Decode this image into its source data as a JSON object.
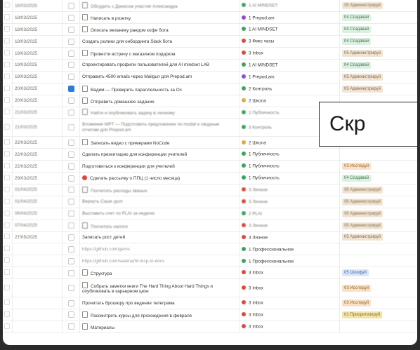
{
  "table": {
    "rows": [
      {
        "date": "16/03/2025",
        "checked": false,
        "icon": "page-icon",
        "task": "Обсудить с Данисом участие Александра",
        "cat": "1 AI MINDSET",
        "cat_color": "#3aa55e",
        "status": "05 Администрируй",
        "status_bg": "#efe5d6",
        "status_fg": "#8a6a3a",
        "blur": true
      },
      {
        "date": "18/03/2025",
        "checked": false,
        "icon": "page-icon",
        "task": "Написать в розетку",
        "cat": "1 Prepod.am",
        "cat_color": "#8a4fd6",
        "status": "04 Создавай",
        "status_bg": "#dcefe0",
        "status_fg": "#3f7a4f",
        "blur": false
      },
      {
        "date": "18/03/2025",
        "checked": false,
        "icon": "page-icon",
        "task": "Описать механику рандом кофе бота",
        "cat": "1 AI MINDSET",
        "cat_color": "#3aa55e",
        "status": "04 Создавай",
        "status_bg": "#dcefe0",
        "status_fg": "#3f7a4f",
        "blur": false
      },
      {
        "date": "18/03/2025",
        "checked": false,
        "icon": "",
        "task": "Создать ролики для онбординга Slack бота",
        "cat": "3 Фикс часы",
        "cat_color": "#e0483c",
        "status": "04 Создавай",
        "status_bg": "#dcefe0",
        "status_fg": "#3f7a4f",
        "blur": false
      },
      {
        "date": "19/03/2025",
        "checked": false,
        "icon": "page-icon",
        "task": "Провести встречу с магазином подарков",
        "cat": "3 Inbox",
        "cat_color": "#e0483c",
        "status": "05 Администрируй",
        "status_bg": "#efe5d6",
        "status_fg": "#8a6a3a",
        "blur": false
      },
      {
        "date": "19/03/2025",
        "checked": false,
        "icon": "",
        "task": "Спроектировать профили пользователей для AI mindset LAB",
        "cat": "1 AI MINDSET",
        "cat_color": "#3aa55e",
        "status": "04 Создавай",
        "status_bg": "#dcefe0",
        "status_fg": "#3f7a4f",
        "blur": false
      },
      {
        "date": "19/03/2025",
        "checked": false,
        "icon": "",
        "task": "Отправить 4500 emails через Mailgun для Prepod.am",
        "cat": "1 Prepod.am",
        "cat_color": "#8a4fd6",
        "status": "05 Администрируй",
        "status_bg": "#efe5d6",
        "status_fg": "#8a6a3a",
        "blur": false
      },
      {
        "date": "20/03/2025",
        "checked": true,
        "icon": "page-icon",
        "task": "Вадим — Проверить параллельность за Ос",
        "cat": "2 Контроль",
        "cat_color": "#3aa55e",
        "status": "05 Администрируй",
        "status_bg": "#efe5d6",
        "status_fg": "#8a6a3a",
        "blur": false
      },
      {
        "date": "20/03/2025",
        "checked": false,
        "icon": "page-icon",
        "task": "Отправить домашнее задание",
        "cat": "2 Школа",
        "cat_color": "#e5a93a",
        "status": "",
        "status_bg": "",
        "status_fg": "",
        "blur": false
      },
      {
        "date": "21/03/2025",
        "checked": false,
        "icon": "page-icon",
        "task": "Найти и опубликовать задачу в личному",
        "cat": "1 Публичность",
        "cat_color": "#3aa55e",
        "status": "",
        "status_bg": "",
        "status_fg": "",
        "blur": true
      },
      {
        "date": "21/03/2025",
        "checked": false,
        "icon": "",
        "task": "Вложение MPT — Подготовить предложение по modal и сводным отчетам для Prepod.am",
        "cat": "3 Контроль",
        "cat_color": "#3aa55e",
        "status": "",
        "status_bg": "",
        "status_fg": "",
        "blur": true,
        "tall": true
      },
      {
        "date": "22/03/2025",
        "checked": false,
        "icon": "page-icon",
        "task": "Записать видео с примерами NoCode",
        "cat": "2 Школа",
        "cat_color": "#e5a93a",
        "status": "",
        "status_bg": "",
        "status_fg": "",
        "blur": false
      },
      {
        "date": "22/03/2025",
        "checked": false,
        "icon": "",
        "task": "Сделать презентацию для конференции учителей",
        "cat": "1 Публичность",
        "cat_color": "#3aa55e",
        "status": "",
        "status_bg": "",
        "status_fg": "",
        "blur": false
      },
      {
        "date": "22/03/2025",
        "checked": false,
        "icon": "",
        "task": "Подготовиться к конференции для учителей",
        "cat": "1 Публичность",
        "cat_color": "#3aa55e",
        "status": "03 Исследуй",
        "status_bg": "#f7e2c9",
        "status_fg": "#a0662a",
        "blur": false
      },
      {
        "date": "29/03/2025",
        "checked": false,
        "icon": "red-dot",
        "task": "Сделать рассылку о ППЦ (1 число месяца)",
        "cat": "1 Публичность",
        "cat_color": "#3aa55e",
        "status": "04 Создавай",
        "status_bg": "#dcefe0",
        "status_fg": "#3f7a4f",
        "blur": false
      },
      {
        "date": "01/04/2025",
        "checked": false,
        "icon": "page-icon",
        "task": "Посчитать расходы званых",
        "cat": "3 Личное",
        "cat_color": "#e0483c",
        "status": "05 Администрируй",
        "status_bg": "#efe5d6",
        "status_fg": "#8a6a3a",
        "blur": true
      },
      {
        "date": "01/04/2025",
        "checked": false,
        "icon": "",
        "task": "Вернуть Саше долг",
        "cat": "3 Личное",
        "cat_color": "#e0483c",
        "status": "05 Администрируй",
        "status_bg": "#efe5d6",
        "status_fg": "#8a6a3a",
        "blur": true
      },
      {
        "date": "06/04/2025",
        "checked": false,
        "icon": "",
        "task": "Выставить счет по PLAI за неделю",
        "cat": "2 PLAI",
        "cat_color": "#3aa55e",
        "status": "05 Администрируй",
        "status_bg": "#efe5d6",
        "status_fg": "#8a6a3a",
        "blur": true
      },
      {
        "date": "07/04/2025",
        "checked": false,
        "icon": "page-icon",
        "task": "Посчитать налоги",
        "cat": "3 Личное",
        "cat_color": "#e0483c",
        "status": "05 Администрируй",
        "status_bg": "#efe5d6",
        "status_fg": "#8a6a3a",
        "blur": true
      },
      {
        "date": "27/05/2025",
        "checked": false,
        "icon": "",
        "task": "Записать рост детей",
        "cat": "3 Личное",
        "cat_color": "#e0483c",
        "status": "05 Администрируй",
        "status_bg": "#efe5d6",
        "status_fg": "#8a6a3a",
        "blur": false
      },
      {
        "date": "",
        "checked": false,
        "icon": "",
        "task": "https://github.com/gems",
        "cat": "1 Профессиональное",
        "cat_color": "#3aa55e",
        "status": "",
        "status_bg": "",
        "status_fg": "",
        "blur": false,
        "link": true
      },
      {
        "date": "",
        "checked": false,
        "icon": "",
        "task": "https://github.com/saxena/hf-mcp-to-docs",
        "cat": "1 Профессиональное",
        "cat_color": "#3aa55e",
        "status": "",
        "status_bg": "",
        "status_fg": "",
        "blur": false,
        "link": true
      },
      {
        "date": "",
        "checked": false,
        "icon": "page-icon",
        "task": "Структура",
        "cat": "3 Inbox",
        "cat_color": "#e0483c",
        "status": "05 Шлифуй",
        "status_bg": "#dbe7f7",
        "status_fg": "#3d6aa8",
        "blur": false
      },
      {
        "date": "",
        "checked": false,
        "icon": "page-icon",
        "task": "Собрать заметки книги The Hard Thing About Hard Things и опубликовать в карьерном цехе",
        "cat": "3 Inbox",
        "cat_color": "#e0483c",
        "status": "03 Исследуй",
        "status_bg": "#f7e2c9",
        "status_fg": "#a0662a",
        "blur": false,
        "tall": true
      },
      {
        "date": "",
        "checked": false,
        "icon": "",
        "task": "Прочитать брошюру про ведение телеграма",
        "cat": "3 Inbox",
        "cat_color": "#e0483c",
        "status": "03 Исследуй",
        "status_bg": "#f7e2c9",
        "status_fg": "#a0662a",
        "blur": false
      },
      {
        "date": "",
        "checked": false,
        "icon": "page-icon",
        "task": "Рассмотреть курсы для прохождения в феврале",
        "cat": "3 Inbox",
        "cat_color": "#e0483c",
        "status": "01 Приоритизируй",
        "status_bg": "#f1e4a8",
        "status_fg": "#8a7326",
        "blur": false
      },
      {
        "date": "",
        "checked": false,
        "icon": "page-icon",
        "task": "Материалы",
        "cat": "3 Inbox",
        "cat_color": "#e0483c",
        "status": "",
        "status_bg": "",
        "status_fg": "",
        "blur": false
      }
    ]
  },
  "overlay": {
    "text": "Скр"
  }
}
